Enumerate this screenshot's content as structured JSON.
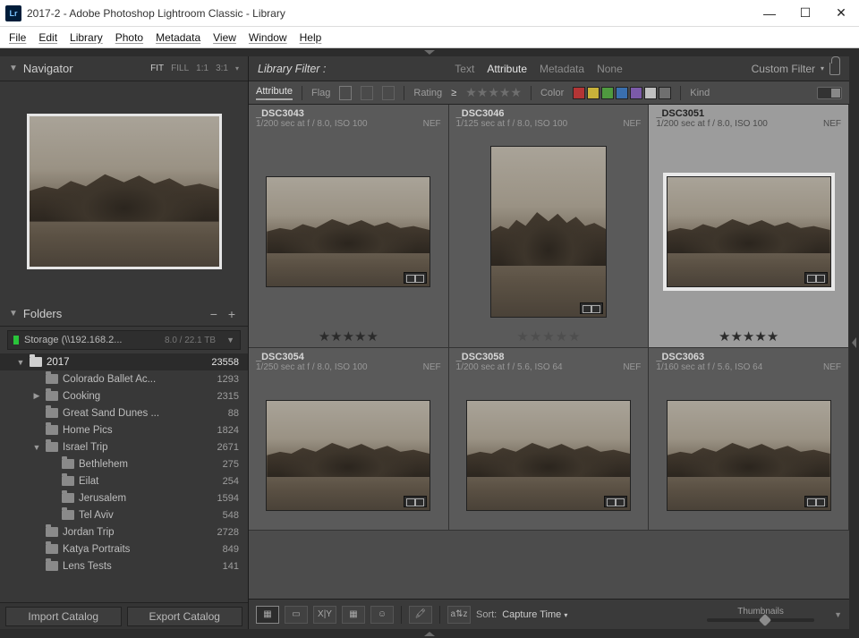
{
  "window": {
    "icon_label": "Lr",
    "title": "2017-2 - Adobe Photoshop Lightroom Classic - Library",
    "controls": {
      "min": "—",
      "max": "☐",
      "close": "✕"
    }
  },
  "menu": [
    "File",
    "Edit",
    "Library",
    "Photo",
    "Metadata",
    "View",
    "Window",
    "Help"
  ],
  "navigator": {
    "title": "Navigator",
    "modes": [
      "FIT",
      "FILL",
      "1:1",
      "3:1"
    ],
    "dropdown_hint": "···"
  },
  "folders": {
    "title": "Folders",
    "add_remove": "− +",
    "volume": {
      "name": "Storage (\\\\192.168.2...",
      "usage": "8.0 / 22.1 TB"
    },
    "tree": [
      {
        "depth": 0,
        "expander": "▼",
        "label": "2017",
        "count": "23558",
        "selected": true
      },
      {
        "depth": 1,
        "expander": "",
        "label": "Colorado Ballet Ac...",
        "count": "1293"
      },
      {
        "depth": 1,
        "expander": "▶",
        "label": "Cooking",
        "count": "2315"
      },
      {
        "depth": 1,
        "expander": "",
        "label": "Great Sand Dunes ...",
        "count": "88"
      },
      {
        "depth": 1,
        "expander": "",
        "label": "Home Pics",
        "count": "1824"
      },
      {
        "depth": 1,
        "expander": "▼",
        "label": "Israel Trip",
        "count": "2671"
      },
      {
        "depth": 2,
        "expander": "",
        "label": "Bethlehem",
        "count": "275"
      },
      {
        "depth": 2,
        "expander": "",
        "label": "Eilat",
        "count": "254"
      },
      {
        "depth": 2,
        "expander": "",
        "label": "Jerusalem",
        "count": "1594"
      },
      {
        "depth": 2,
        "expander": "",
        "label": "Tel Aviv",
        "count": "548"
      },
      {
        "depth": 1,
        "expander": "",
        "label": "Jordan Trip",
        "count": "2728"
      },
      {
        "depth": 1,
        "expander": "",
        "label": "Katya Portraits",
        "count": "849"
      },
      {
        "depth": 1,
        "expander": "",
        "label": "Lens Tests",
        "count": "141"
      }
    ],
    "buttons": {
      "import": "Import Catalog",
      "export": "Export Catalog"
    }
  },
  "filter": {
    "label": "Library Filter :",
    "tabs": [
      "Text",
      "Attribute",
      "Metadata",
      "None"
    ],
    "active_tab": "Attribute",
    "custom": "Custom Filter"
  },
  "attr_bar": {
    "active": "Attribute",
    "flag_label": "Flag",
    "rating_label": "Rating",
    "rating_op": "≥",
    "color_label": "Color",
    "colors": [
      "#b33535",
      "#c8b23a",
      "#4f9a3f",
      "#3a6fae",
      "#7b5aa8",
      "#bfbfbf",
      "#6f6f6f"
    ],
    "kind_label": "Kind"
  },
  "thumbs": [
    {
      "row": 0,
      "name": "_DSC3043",
      "exif": "1/200 sec at f / 8.0, ISO 100",
      "fmt": "NEF",
      "orient": "wide",
      "rating": 5,
      "selected": false
    },
    {
      "row": 0,
      "name": "_DSC3046",
      "exif": "1/125 sec at f / 8.0, ISO 100",
      "fmt": "NEF",
      "orient": "tall",
      "rating": 0,
      "selected": false
    },
    {
      "row": 0,
      "name": "_DSC3051",
      "exif": "1/200 sec at f / 8.0, ISO 100",
      "fmt": "NEF",
      "orient": "wide",
      "rating": 5,
      "selected": true
    },
    {
      "row": 1,
      "name": "_DSC3054",
      "exif": "1/250 sec at f / 8.0, ISO 100",
      "fmt": "NEF",
      "orient": "wide",
      "rating": 0,
      "selected": false
    },
    {
      "row": 1,
      "name": "_DSC3058",
      "exif": "1/200 sec at f / 5.6, ISO 64",
      "fmt": "NEF",
      "orient": "wide",
      "rating": 0,
      "selected": false
    },
    {
      "row": 1,
      "name": "_DSC3063",
      "exif": "1/160 sec at f / 5.6, ISO 64",
      "fmt": "NEF",
      "orient": "wide",
      "rating": 0,
      "selected": false
    }
  ],
  "toolbar": {
    "sort_label": "Sort:",
    "sort_value": "Capture Time",
    "slider_label": "Thumbnails"
  }
}
